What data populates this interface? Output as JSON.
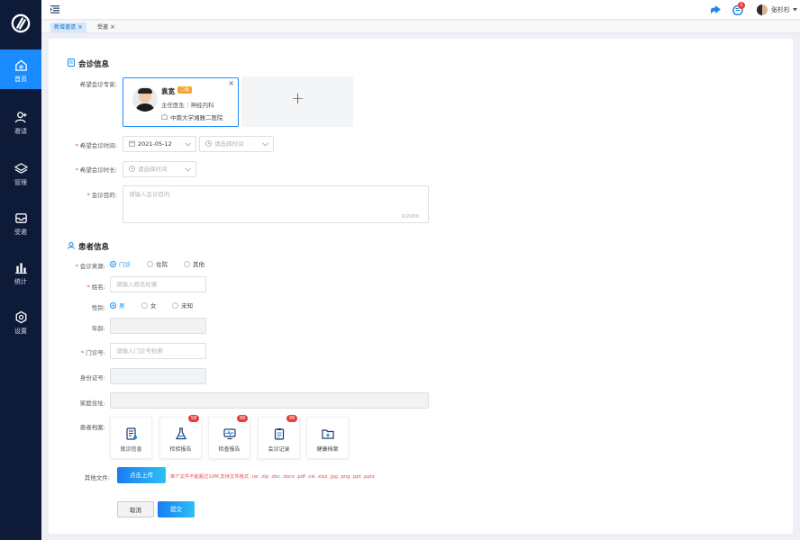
{
  "nav": {
    "items": [
      {
        "label": "首页",
        "icon": "home-icon",
        "active": true
      },
      {
        "label": "邀请",
        "icon": "add-user-icon"
      },
      {
        "label": "管理",
        "icon": "layers-icon"
      },
      {
        "label": "受邀",
        "icon": "inbox-icon"
      },
      {
        "label": "统计",
        "icon": "bar-chart-icon"
      },
      {
        "label": "设置",
        "icon": "gear-icon"
      }
    ]
  },
  "header": {
    "user_name": "张杉杉",
    "notification_count": "2"
  },
  "tabs": [
    {
      "label": "新增邀请",
      "active": true
    },
    {
      "label": "受邀",
      "active": false
    }
  ],
  "consult": {
    "section_title": "会诊信息",
    "expert_label": "希望会诊专家:",
    "expert": {
      "name": "袁宽",
      "level_badge": "二级",
      "title": "主任医生｜神经内科",
      "hospital": "中南大学湘雅二医院"
    },
    "add_symbol": "+",
    "time_label": "希望会诊时间:",
    "date_value": "2021-05-12",
    "time_placeholder": "请选择时间",
    "duration_label": "希望会诊时长:",
    "duration_placeholder": "请选择时间",
    "purpose_label": "会诊目的:",
    "purpose_placeholder": "请输入会诊目的",
    "purpose_counter": "0/2000"
  },
  "patient": {
    "section_title": "患者信息",
    "source_label": "会诊来源:",
    "source_options": [
      "门诊",
      "住院",
      "其他"
    ],
    "name_label": "姓名:",
    "name_placeholder": "请输入姓名检索",
    "gender_label": "性别:",
    "gender_options": [
      "男",
      "女",
      "未知"
    ],
    "age_label": "年龄:",
    "clinic_no_label": "门诊号:",
    "clinic_no_placeholder": "请输入门诊号检索",
    "id_label": "身份证号:",
    "address_label": "家庭住址:",
    "records_label": "患者档案:",
    "records": [
      {
        "label": "就诊信息",
        "icon": "document-icon",
        "badge": ""
      },
      {
        "label": "检验报告",
        "icon": "flask-icon",
        "badge": "58"
      },
      {
        "label": "检查报告",
        "icon": "monitor-icon",
        "badge": "99"
      },
      {
        "label": "会诊记录",
        "icon": "clipboard-icon",
        "badge": "99"
      },
      {
        "label": "健康档案",
        "icon": "folder-add-icon",
        "badge": ""
      }
    ],
    "other_files_label": "其他文件:",
    "upload_button": "点击上传",
    "upload_hint": "单个文件不能超过10M,支持文件格式 .rar .zip .doc .docx .pdf .xls .xlsx .jpg .png .ppt .pptx"
  },
  "actions": {
    "cancel": "取消",
    "submit": "提交"
  },
  "colors": {
    "sidebar_bg": "#0d1a38",
    "accent": "#1a8cff",
    "required": "#e64b4b",
    "badge": "#e43d3d"
  }
}
